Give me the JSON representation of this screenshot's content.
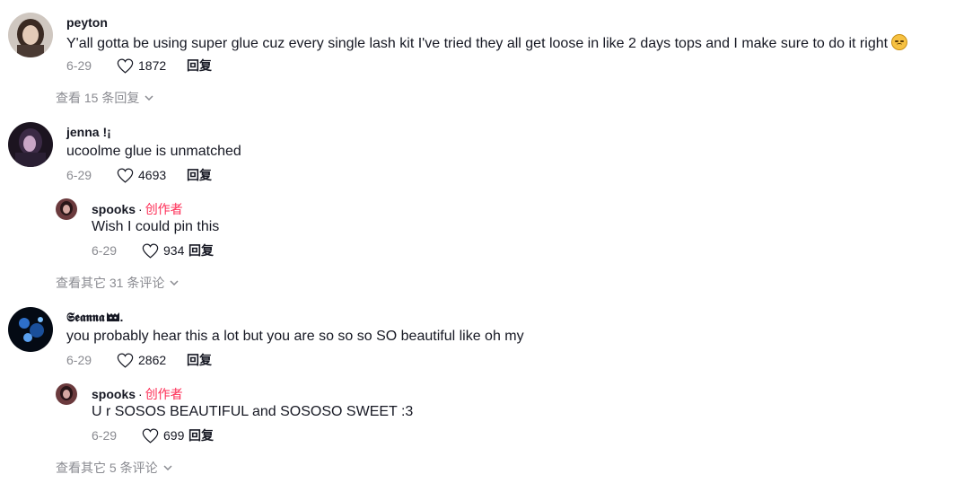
{
  "comments": [
    {
      "username": "peyton",
      "text": "Y'all gotta be using super glue cuz every single lash kit I've tried they all get loose in like 2 days tops and I make sure to do it right",
      "date": "6-29",
      "likes": "1872",
      "reply_label": "回复",
      "emoji": "disappointed-face",
      "view_more": "查看 15 条回复"
    },
    {
      "username": "jenna !¡",
      "text": "ucoolme glue is unmatched",
      "date": "6-29",
      "likes": "4693",
      "reply_label": "回复",
      "reply": {
        "username": "spooks",
        "separator": "·",
        "author_tag": "创作者",
        "text": "Wish I could pin this",
        "date": "6-29",
        "likes": "934",
        "reply_label": "回复"
      },
      "view_more": "查看其它 31 条评论"
    },
    {
      "username": "𝕾𝖊𝖆𝖓𝖓𝖆",
      "username_suffix": ".",
      "text": "you probably hear this a lot but you are so so so SO beautiful like oh my",
      "date": "6-29",
      "likes": "2862",
      "reply_label": "回复",
      "reply": {
        "username": "spooks",
        "separator": "·",
        "author_tag": "创作者",
        "text": "U r SOSOS BEAUTIFUL and SOSOSO SWEET :3",
        "date": "6-29",
        "likes": "699",
        "reply_label": "回复"
      },
      "view_more": "查看其它 5 条评论"
    }
  ],
  "colors": {
    "text": "#161823",
    "muted": "#8a8b91",
    "author_tag": "#fe2c55"
  }
}
